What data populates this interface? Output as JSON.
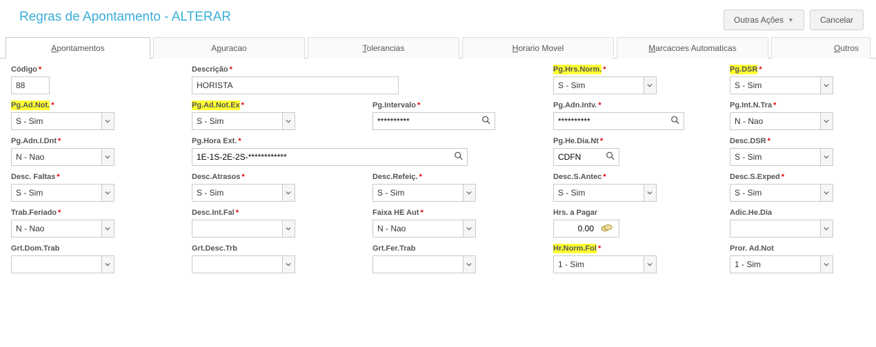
{
  "header": {
    "title": "Regras de Apontamento - ALTERAR",
    "outras_acoes": "Outras Ações",
    "cancelar": "Cancelar"
  },
  "tabs": {
    "apontamentos": "Apontamentos",
    "apuracao": "Apuracao",
    "tolerancias": "Tolerancias",
    "horario_movel": "Horario Movel",
    "marcacoes_automaticas": "Marcacoes Automaticas",
    "outros": "Outros"
  },
  "fields": {
    "codigo": {
      "label": "Código",
      "value": "88"
    },
    "descricao": {
      "label": "Descrição",
      "value": "HORISTA"
    },
    "pg_hrs_norm": {
      "label": "Pg.Hrs.Norm.",
      "value": "S - Sim"
    },
    "pg_dsr": {
      "label": "Pg.DSR",
      "value": "S - Sim"
    },
    "pg_ad_not": {
      "label": "Pg.Ad.Not.",
      "value": "S - Sim"
    },
    "pg_ad_not_ex": {
      "label": "Pg.Ad.Not.Ex",
      "value": "S - Sim"
    },
    "pg_intervalo": {
      "label": "Pg.Intervalo",
      "value": "**********"
    },
    "pg_adn_intv": {
      "label": "Pg.Adn.Intv.",
      "value": "**********"
    },
    "pg_int_n_tra": {
      "label": "Pg.Int.N.Tra",
      "value": "N - Nao"
    },
    "pg_adn_i_dnt": {
      "label": "Pg.Adn.I.Dnt",
      "value": "N - Nao"
    },
    "pg_hora_ext": {
      "label": "Pg.Hora Ext.",
      "value": "1E-1S-2E-2S-************"
    },
    "pg_he_dia_nt": {
      "label": "Pg.He.Dia.Nt",
      "value": "CDFN"
    },
    "desc_dsr": {
      "label": "Desc.DSR",
      "value": "S - Sim"
    },
    "desc_faltas": {
      "label": "Desc. Faltas",
      "value": "S - Sim"
    },
    "desc_atrasos": {
      "label": "Desc.Atrasos",
      "value": "S - Sim"
    },
    "desc_refeic": {
      "label": "Desc.Refeiç.",
      "value": "S - Sim"
    },
    "desc_s_antec": {
      "label": "Desc.S.Antec",
      "value": "S - Sim"
    },
    "desc_s_exped": {
      "label": "Desc.S.Exped",
      "value": "S - Sim"
    },
    "trab_feriado": {
      "label": "Trab.Feriado",
      "value": "N - Nao"
    },
    "desc_int_fal": {
      "label": "Desc.Int.Fal",
      "value": ""
    },
    "faixa_he_aut": {
      "label": "Faixa HE Aut",
      "value": "N - Nao"
    },
    "hrs_a_pagar": {
      "label": "Hrs. a Pagar",
      "value": "0.00"
    },
    "adic_he_dia": {
      "label": "Adic.He.Dia",
      "value": ""
    },
    "grt_dom_trab": {
      "label": "Grt.Dom.Trab",
      "value": ""
    },
    "grt_desc_trb": {
      "label": "Grt.Desc.Trb",
      "value": ""
    },
    "grt_fer_trab": {
      "label": "Grt.Fer.Trab",
      "value": ""
    },
    "hr_norm_fol": {
      "label": "Hr.Norm.Fol",
      "value": "1 - Sim"
    },
    "pror_ad_not": {
      "label": "Pror. Ad.Not",
      "value": "1 - Sim"
    }
  }
}
